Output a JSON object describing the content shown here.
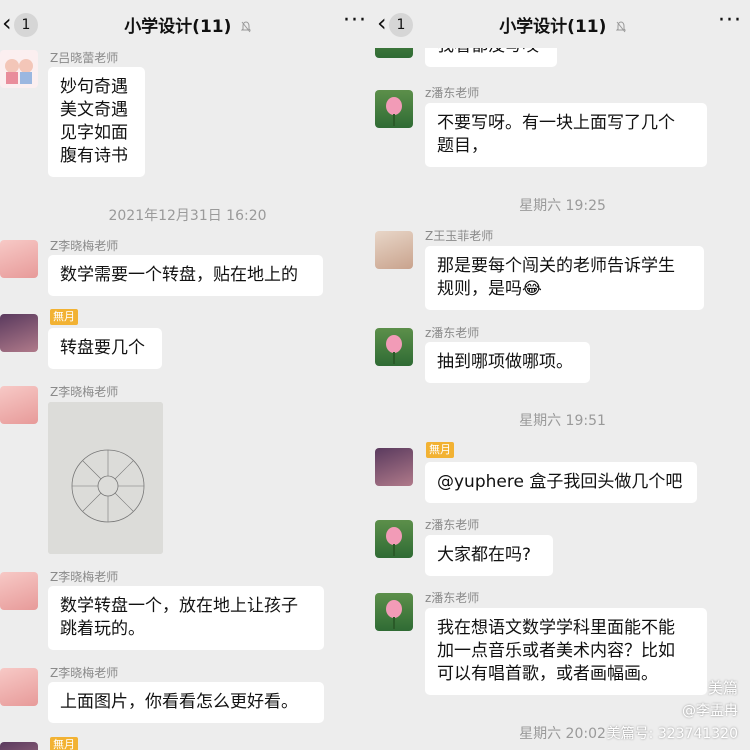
{
  "left": {
    "header": {
      "back_count": "1",
      "title": "小学设计(11)",
      "more": "···"
    },
    "messages": [
      {
        "sender": "Z吕晓蕾老师",
        "text": "妙句奇遇\n美文奇遇\n见字如面\n腹有诗书"
      },
      {
        "sender": "Z李晓梅老师",
        "text": "数学需要一个转盘，贴在地上的"
      },
      {
        "badge": "無月",
        "text": "转盘要几个"
      },
      {
        "sender": "Z李晓梅老师"
      },
      {
        "sender": "Z李晓梅老师",
        "text": "数学转盘一个，放在地上让孩子\n跳着玩的。"
      },
      {
        "sender": "Z李晓梅老师",
        "text": "上面图片，你看看怎么更好看。"
      },
      {
        "badge": "無月"
      }
    ],
    "times": [
      "2021年12月31日 16:20"
    ]
  },
  "right": {
    "header": {
      "back_count": "1",
      "title": "小学设计(11)",
      "more": "···"
    },
    "messages": [
      {
        "text": "我看都没写哎"
      },
      {
        "sender": "z潘东老师",
        "text": "不要写呀。有一块上面写了几个\n题目，"
      },
      {
        "sender": "Z王玉菲老师",
        "text": "那是要每个闯关的老师告诉学生\n规则，是吗😂"
      },
      {
        "sender": "z潘东老师",
        "text": "抽到哪项做哪项。"
      },
      {
        "badge": "無月",
        "text": "@yuphere 盒子我回头做几个吧"
      },
      {
        "sender": "z潘东老师",
        "text": "大家都在吗?"
      },
      {
        "sender": "z潘东老师",
        "text": "我在想语文数学学科里面能不能\n加一点音乐或者美术内容？比如\n可以有唱首歌，或者画幅画。"
      }
    ],
    "times": [
      "星期六 19:25",
      "星期六 19:51",
      "星期六 20:02"
    ],
    "watermark": {
      "brand": "美篇",
      "user": "@李盂冉",
      "id": "美篇号: 323741320"
    }
  },
  "colors": {
    "background": "#ededed",
    "bubble": "#ffffff",
    "badge": "#f2b233"
  }
}
